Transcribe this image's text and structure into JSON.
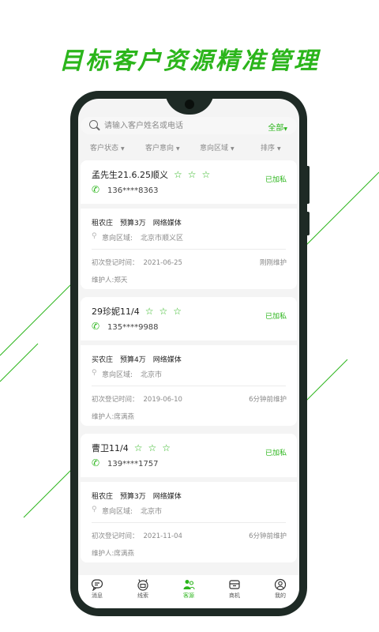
{
  "headline": "目标客户资源精准管理",
  "search": {
    "placeholder": "请输入客户姓名或电话",
    "scope": "全部"
  },
  "filters": [
    "客户状态",
    "客户意向",
    "意向区域",
    "排序"
  ],
  "area_label": "意向区域:",
  "first_register_label": "初次登记时间：",
  "owner_label": "维护人:",
  "customers": [
    {
      "name": "孟先生21.6.25顺义",
      "stars": 3,
      "status": "已加私",
      "phone": "136****8363",
      "tags": [
        "租农庄",
        "预算3万",
        "网络媒体"
      ],
      "area": "北京市顺义区",
      "date": "2021-06-25",
      "last_maintained": "刚刚维护",
      "owner": "郑天"
    },
    {
      "name": "29珍妮11/4",
      "stars": 3,
      "status": "已加私",
      "phone": "135****9988",
      "tags": [
        "买农庄",
        "预算4万",
        "网络媒体"
      ],
      "area": "北京市",
      "date": "2019-06-10",
      "last_maintained": "6分钟前维护",
      "owner": "席满燕"
    },
    {
      "name": "曹卫11/4",
      "stars": 3,
      "status": "已加私",
      "phone": "139****1757",
      "tags": [
        "租农庄",
        "预算3万",
        "网络媒体"
      ],
      "area": "北京市",
      "date": "2021-11-04",
      "last_maintained": "6分钟前维护",
      "owner": "席满燕"
    }
  ],
  "tabs": [
    {
      "label": "消息",
      "icon": "message-icon",
      "active": false
    },
    {
      "label": "线索",
      "icon": "leads-icon",
      "active": false
    },
    {
      "label": "客源",
      "icon": "customers-icon",
      "active": true
    },
    {
      "label": "商机",
      "icon": "business-icon",
      "active": false
    },
    {
      "label": "我的",
      "icon": "profile-icon",
      "active": false
    }
  ],
  "colors": {
    "accent": "#2bb51b",
    "phone_frame": "#1e2a25"
  }
}
